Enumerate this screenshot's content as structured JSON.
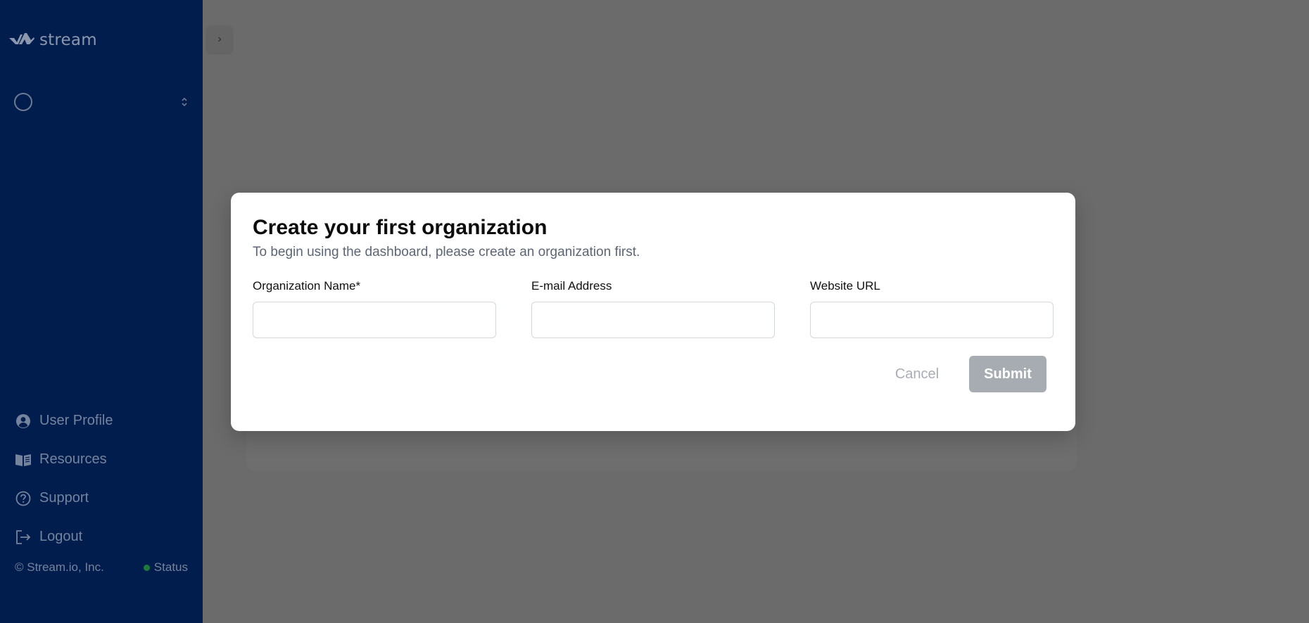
{
  "app": {
    "logo_text": "stream"
  },
  "org_switcher": {
    "selected": ""
  },
  "sidebar": {
    "items": [
      {
        "label": "User Profile",
        "icon": "user-circle-icon"
      },
      {
        "label": "Resources",
        "icon": "book-icon"
      },
      {
        "label": "Support",
        "icon": "question-circle-icon"
      },
      {
        "label": "Logout",
        "icon": "logout-icon"
      }
    ],
    "footer": {
      "copyright": "© Stream.io, Inc.",
      "status_label": "Status",
      "status_color": "#1c7a3a"
    }
  },
  "modal": {
    "title": "Create your first organization",
    "subtitle": "To begin using the dashboard, please create an organization first.",
    "fields": [
      {
        "label": "Organization Name*",
        "value": "",
        "placeholder": ""
      },
      {
        "label": "E-mail Address",
        "value": "",
        "placeholder": ""
      },
      {
        "label": "Website URL",
        "value": "",
        "placeholder": ""
      }
    ],
    "cancel_label": "Cancel",
    "submit_label": "Submit"
  },
  "colors": {
    "sidebar_bg": "#001d4d",
    "overlay": "#6b6b6b",
    "submit_disabled": "#a7abb2"
  }
}
